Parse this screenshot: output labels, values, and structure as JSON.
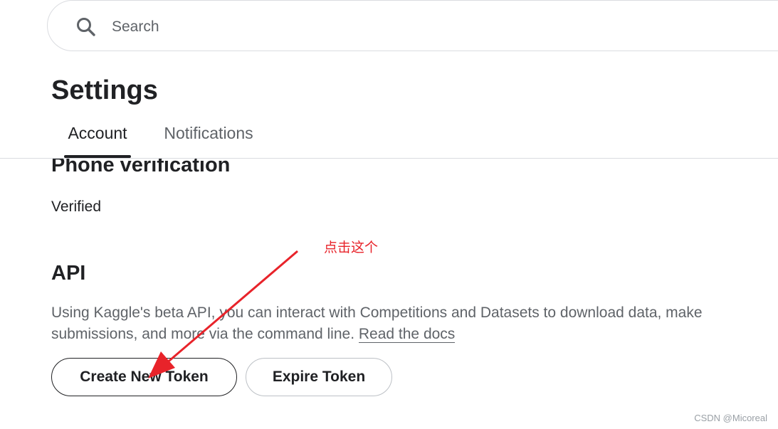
{
  "search": {
    "placeholder": "Search"
  },
  "page": {
    "title": "Settings"
  },
  "tabs": [
    {
      "label": "Account",
      "active": true
    },
    {
      "label": "Notifications",
      "active": false
    }
  ],
  "phone_verification": {
    "heading": "Phone verification",
    "status": "Verified"
  },
  "api": {
    "heading": "API",
    "description": "Using Kaggle's beta API, you can interact with Competitions and Datasets to download data, make submissions, and more via the command line.",
    "docs_link": "Read the docs",
    "create_button": "Create New Token",
    "expire_button": "Expire Token"
  },
  "annotation": {
    "text": "点击这个",
    "color": "#e8232a"
  },
  "watermark": "CSDN @Micoreal",
  "icons": {
    "search": "search-icon",
    "arrow": "red-arrow-icon"
  }
}
